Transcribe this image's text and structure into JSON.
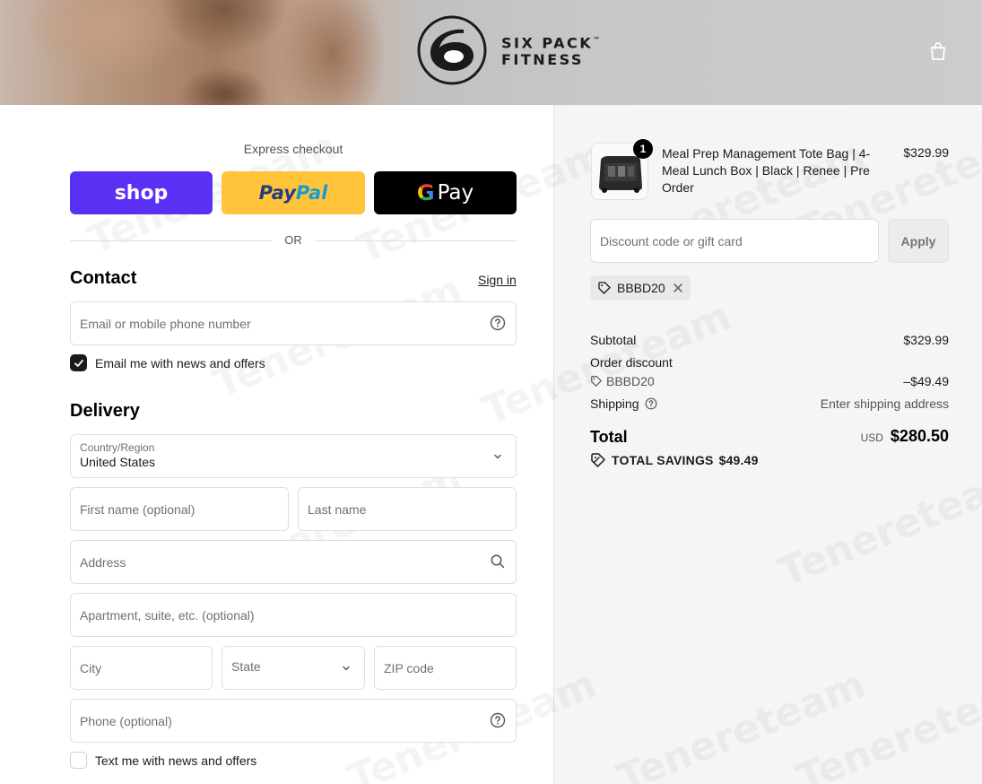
{
  "header": {
    "brand_line1": "SIX PACK",
    "brand_tm": "™",
    "brand_line2": "FITNESS"
  },
  "express": {
    "title": "Express checkout",
    "shop_label": "shop",
    "paypal_part1": "Pay",
    "paypal_part2": "Pal",
    "gpay_g": "G",
    "gpay_label": "Pay",
    "or_label": "OR"
  },
  "contact": {
    "title": "Contact",
    "sign_in": "Sign in",
    "email_placeholder": "Email or mobile phone number",
    "email_optin_label": "Email me with news and offers",
    "email_optin_checked": true
  },
  "delivery": {
    "title": "Delivery",
    "country_label": "Country/Region",
    "country_value": "United States",
    "first_name_placeholder": "First name (optional)",
    "last_name_placeholder": "Last name",
    "address_placeholder": "Address",
    "apartment_placeholder": "Apartment, suite, etc. (optional)",
    "city_placeholder": "City",
    "state_placeholder": "State",
    "zip_placeholder": "ZIP code",
    "phone_placeholder": "Phone (optional)",
    "text_optin_label": "Text me with news and offers",
    "text_optin_checked": false
  },
  "order": {
    "item": {
      "quantity": "1",
      "name": "Meal Prep Management Tote Bag | 4-Meal Lunch Box | Black | Renee | Pre Order",
      "price": "$329.99"
    },
    "discount_placeholder": "Discount code or gift card",
    "apply_label": "Apply",
    "applied_code": "BBBD20",
    "subtotal_label": "Subtotal",
    "subtotal_value": "$329.99",
    "order_discount_label": "Order discount",
    "order_discount_code": "BBBD20",
    "order_discount_value": "–$49.49",
    "shipping_label": "Shipping",
    "shipping_value": "Enter shipping address",
    "total_label": "Total",
    "total_currency": "USD",
    "total_value": "$280.50",
    "savings_label": "TOTAL SAVINGS",
    "savings_value": "$49.49"
  },
  "watermark": "Tenereteam",
  "colors": {
    "shop_pay": "#5a31f4",
    "paypal": "#ffc439",
    "gpay": "#000000",
    "panel_bg": "#f5f5f5",
    "text": "#1a1a1a"
  }
}
